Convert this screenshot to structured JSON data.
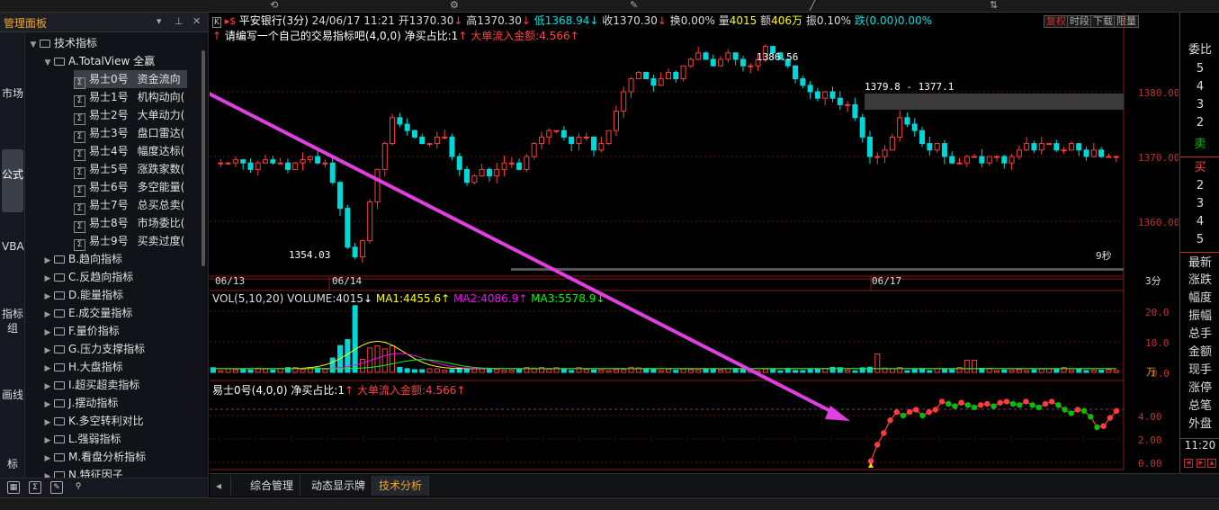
{
  "left_panel": {
    "title": "管理面板",
    "vtabs": [
      "市场",
      "公式",
      "VBA",
      "指标组",
      "画线",
      "标"
    ],
    "tree": {
      "root": "技术指标",
      "group_a": "A.TotalView 全赢",
      "items": [
        {
          "name": "易士0号",
          "desc": "资金流向"
        },
        {
          "name": "易士1号",
          "desc": "机构动向("
        },
        {
          "name": "易士2号",
          "desc": "大单动力("
        },
        {
          "name": "易士3号",
          "desc": "盘口雷达("
        },
        {
          "name": "易士4号",
          "desc": "幅度达标("
        },
        {
          "name": "易士5号",
          "desc": "涨跌家数("
        },
        {
          "name": "易士6号",
          "desc": "多空能量("
        },
        {
          "name": "易士7号",
          "desc": "总买总卖("
        },
        {
          "name": "易士8号",
          "desc": "市场委比("
        },
        {
          "name": "易士9号",
          "desc": "买卖过度("
        }
      ],
      "groups": [
        "B.趋向指标",
        "C.反趋向指标",
        "D.能量指标",
        "E.成交量指标",
        "F.量价指标",
        "G.压力支撑指标",
        "H.大盘指标",
        "I.超买超卖指标",
        "J.摆动指标",
        "K.多空转利对比",
        "L.强弱指标",
        "M.看盘分析指标",
        "N.特征因子"
      ]
    }
  },
  "header": {
    "k_label": "K",
    "stock_name": "平安银行(3分)",
    "datetime": "24/06/17  11:21",
    "open": "开1370.30",
    "high": "高1370.30",
    "low": "低1368.94",
    "close": "收1370.30",
    "change": "换0.00%",
    "volume_label": "量",
    "volume": "4015",
    "amount_label": "额",
    "amount": "406万",
    "amplitude": "振0.10%",
    "fall": "跌(0.00)0.00%",
    "buttons": [
      "复权",
      "时段",
      "下载",
      "限量"
    ]
  },
  "hint": {
    "text": "请编写一个自己的交易指标吧(4,0,0)",
    "buy_ratio": "净买占比:1",
    "big_flow": "大单流入金额:4.566"
  },
  "price_chart": {
    "y_ticks": [
      "1380.00",
      "1370.00",
      "1360.00"
    ],
    "high_label": "1386.56",
    "low_label": "1354.03",
    "range_label": "1379.8 - 1377.1",
    "timer": "9秒",
    "dates": [
      "06/13",
      "06/14",
      "06/17"
    ],
    "period": "3分"
  },
  "vol": {
    "label": "VOL(5,10,20)",
    "volume": "VOLUME:4015",
    "ma1": "MA1:4455.6",
    "ma2": "MA2:4086.9",
    "ma3": "MA3:5578.9",
    "y_ticks": [
      "20.0",
      "10.0",
      "0.0"
    ],
    "unit": "万",
    "colors": {
      "ma1": "#ffff00",
      "ma2": "#ff00ff",
      "ma3": "#00ff00"
    }
  },
  "indicator": {
    "label": "易士0号(4,0,0)",
    "buy_ratio": "净买占比:1",
    "big_flow": "大单流入金额:4.566",
    "y_ticks": [
      "4.00",
      "2.00",
      "0.00"
    ]
  },
  "right_panel": {
    "weibi": "委比",
    "sell_levels": [
      "5",
      "4",
      "3",
      "2"
    ],
    "sell": "卖",
    "buy": "买",
    "buy_levels": [
      "2",
      "3",
      "4",
      "5"
    ],
    "fields": [
      "最新",
      "涨跌",
      "幅度",
      "振幅",
      "总手",
      "金额",
      "现手",
      "涨停",
      "总笔",
      "外盘"
    ],
    "time": "11:20"
  },
  "tabs": [
    "综合管理",
    "动态显示牌",
    "技术分析"
  ],
  "chart_data": {
    "type": "line",
    "title": "",
    "series": [
      {
        "name": "易士0号",
        "values": [
          0.1,
          1.5,
          2.5,
          3.6,
          4.3,
          4.0,
          4.3,
          4.5,
          4.0,
          4.3,
          4.5,
          5.2,
          5.0,
          4.8,
          5.1,
          4.9,
          4.7,
          4.9,
          5.0,
          4.8,
          5.1,
          5.2,
          5.0,
          4.9,
          5.2,
          4.9,
          4.7,
          5.0,
          5.2,
          4.9,
          4.5,
          4.2,
          4.5,
          4.4,
          3.9,
          3.0,
          3.1,
          3.8,
          4.4
        ]
      }
    ],
    "ylim": [
      0,
      5.5
    ]
  }
}
